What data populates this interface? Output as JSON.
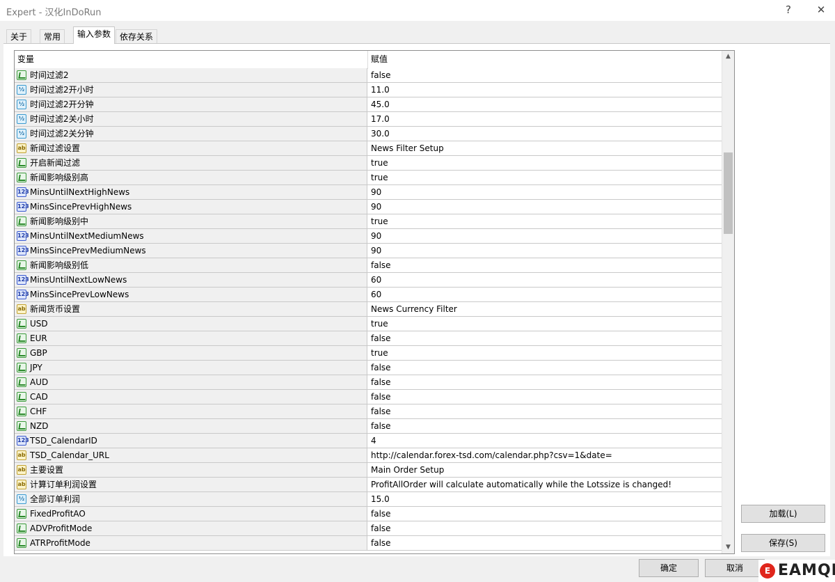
{
  "window": {
    "title": "Expert - 汉化InDoRun",
    "help": "?",
    "close": "✕"
  },
  "tabs": [
    {
      "label": "关于"
    },
    {
      "label": "常用"
    },
    {
      "label": "输入参数"
    },
    {
      "label": "依存关系"
    }
  ],
  "grid": {
    "headers": {
      "name": "变量",
      "value": "赋值"
    },
    "rows": [
      {
        "type": "bool",
        "name": "时间过滤2",
        "value": "false"
      },
      {
        "type": "dbl",
        "name": "时间过滤2开小时",
        "value": "11.0"
      },
      {
        "type": "dbl",
        "name": "时间过滤2开分钟",
        "value": "45.0"
      },
      {
        "type": "dbl",
        "name": "时间过滤2关小时",
        "value": "17.0"
      },
      {
        "type": "dbl",
        "name": "时间过滤2关分钟",
        "value": "30.0"
      },
      {
        "type": "str",
        "name": "新闻过滤设置",
        "value": "News Filter Setup"
      },
      {
        "type": "bool",
        "name": "开启新闻过滤",
        "value": "true"
      },
      {
        "type": "bool",
        "name": "新闻影响级别高",
        "value": "true"
      },
      {
        "type": "int",
        "name": "MinsUntilNextHighNews",
        "value": "90"
      },
      {
        "type": "int",
        "name": "MinsSincePrevHighNews",
        "value": "90"
      },
      {
        "type": "bool",
        "name": "新闻影响级别中",
        "value": "true"
      },
      {
        "type": "int",
        "name": "MinsUntilNextMediumNews",
        "value": "90"
      },
      {
        "type": "int",
        "name": "MinsSincePrevMediumNews",
        "value": "90"
      },
      {
        "type": "bool",
        "name": "新闻影响级别低",
        "value": "false"
      },
      {
        "type": "int",
        "name": "MinsUntilNextLowNews",
        "value": "60"
      },
      {
        "type": "int",
        "name": "MinsSincePrevLowNews",
        "value": "60"
      },
      {
        "type": "str",
        "name": "新闻货币设置",
        "value": "News Currency Filter"
      },
      {
        "type": "bool",
        "name": "USD",
        "value": "true"
      },
      {
        "type": "bool",
        "name": "EUR",
        "value": "false"
      },
      {
        "type": "bool",
        "name": "GBP",
        "value": "true"
      },
      {
        "type": "bool",
        "name": "JPY",
        "value": "false"
      },
      {
        "type": "bool",
        "name": "AUD",
        "value": "false"
      },
      {
        "type": "bool",
        "name": "CAD",
        "value": "false"
      },
      {
        "type": "bool",
        "name": "CHF",
        "value": "false"
      },
      {
        "type": "bool",
        "name": "NZD",
        "value": "false"
      },
      {
        "type": "int",
        "name": "TSD_CalendarID",
        "value": "4"
      },
      {
        "type": "str",
        "name": "TSD_Calendar_URL",
        "value": "http://calendar.forex-tsd.com/calendar.php?csv=1&date="
      },
      {
        "type": "str",
        "name": "主要设置",
        "value": "Main Order Setup"
      },
      {
        "type": "str",
        "name": "计算订单利润设置",
        "value": " ProfitAllOrder will calculate automatically while the Lotssize is changed!"
      },
      {
        "type": "dbl",
        "name": "全部订单利润",
        "value": "15.0"
      },
      {
        "type": "bool",
        "name": "FixedProfitAO",
        "value": "false"
      },
      {
        "type": "bool",
        "name": "ADVProfitMode",
        "value": "false"
      },
      {
        "type": "bool",
        "name": "ATRProfitMode",
        "value": "false"
      }
    ]
  },
  "buttons": {
    "load": "加载(L)",
    "save": "保存(S)",
    "ok": "确定",
    "cancel": "取消"
  },
  "watermark": {
    "mark": "E",
    "text": "EAMQL"
  }
}
